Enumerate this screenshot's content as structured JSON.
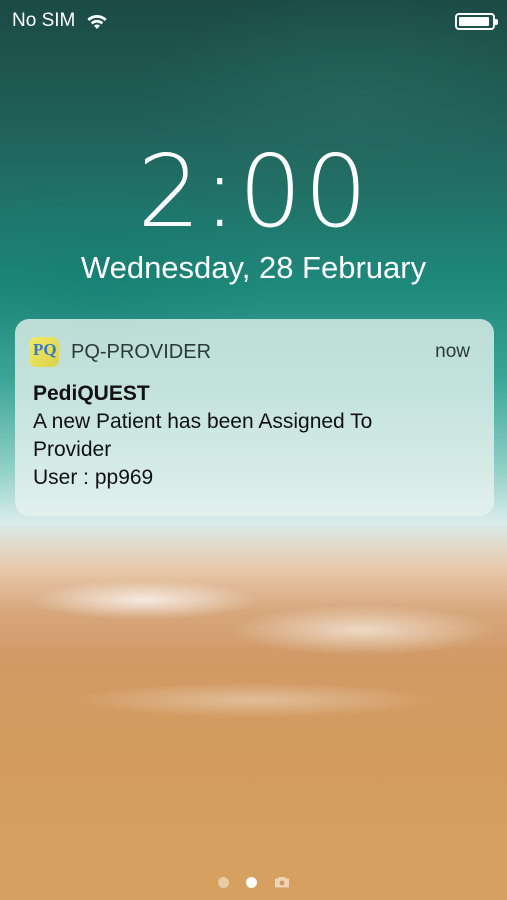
{
  "status_bar": {
    "carrier": "No SIM",
    "wifi_icon": "wifi-icon",
    "battery_icon": "battery-icon"
  },
  "lock_screen": {
    "time": "2:00",
    "date": "Wednesday, 28 February"
  },
  "notification": {
    "app_icon": "pediquest-app-icon",
    "app_icon_text": "PQ",
    "app_name": "PQ-PROVIDER",
    "time": "now",
    "title": "PediQUEST",
    "message_line1": "A new Patient has been Assigned To",
    "message_line2": "Provider",
    "message_line3": "User : pp969"
  },
  "page_indicator": {
    "pages": 3,
    "active_page": 2,
    "camera_icon": "camera-icon"
  },
  "colors": {
    "notification_bg": "#e8f2ee",
    "text_dark": "#111111",
    "text_light": "#ffffff"
  }
}
